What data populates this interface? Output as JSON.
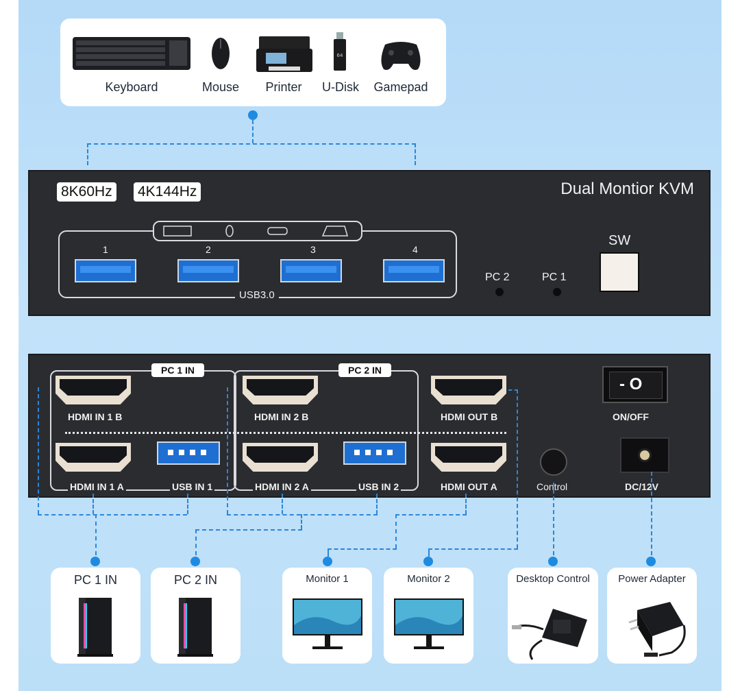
{
  "peripherals": [
    {
      "label": "Keyboard",
      "icon": "keyboard-icon"
    },
    {
      "label": "Mouse",
      "icon": "mouse-icon"
    },
    {
      "label": "Printer",
      "icon": "printer-icon"
    },
    {
      "label": "U-Disk",
      "icon": "usb-drive-icon"
    },
    {
      "label": "Gamepad",
      "icon": "gamepad-icon"
    }
  ],
  "front": {
    "badge1": "8K60Hz",
    "badge2": "4K144Hz",
    "title": "Dual Montior KVM",
    "ports": [
      "1",
      "2",
      "3",
      "4"
    ],
    "usb_label": "USB3.0",
    "pc2": "PC 2",
    "pc1": "PC 1",
    "sw": "SW"
  },
  "back": {
    "group1": "PC 1 IN",
    "group2": "PC 2 IN",
    "hdmi_in_1b": "HDMI IN 1 B",
    "hdmi_in_2b": "HDMI IN 2 B",
    "hdmi_out_b": "HDMI OUT B",
    "hdmi_in_1a": "HDMI IN 1 A",
    "usb_in_1": "USB IN 1",
    "hdmi_in_2a": "HDMI IN 2 A",
    "usb_in_2": "USB IN 2",
    "hdmi_out_a": "HDMI OUT A",
    "control": "Control",
    "onoff": "ON/OFF",
    "dc": "DC/12V",
    "switch_text": "- O"
  },
  "devices": [
    {
      "label": "PC 1 IN",
      "icon": "pc-tower-icon"
    },
    {
      "label": "PC 2 IN",
      "icon": "pc-tower-icon"
    },
    {
      "label": "Monitor 1",
      "icon": "monitor-icon"
    },
    {
      "label": "Monitor 2",
      "icon": "monitor-icon"
    },
    {
      "label": "Desktop Control",
      "icon": "desktop-control-icon"
    },
    {
      "label": "Power Adapter",
      "icon": "power-adapter-icon"
    }
  ],
  "colors": {
    "accent": "#1f8be0",
    "panel": "#2b2c30",
    "usb_blue": "#1e6fd1"
  }
}
